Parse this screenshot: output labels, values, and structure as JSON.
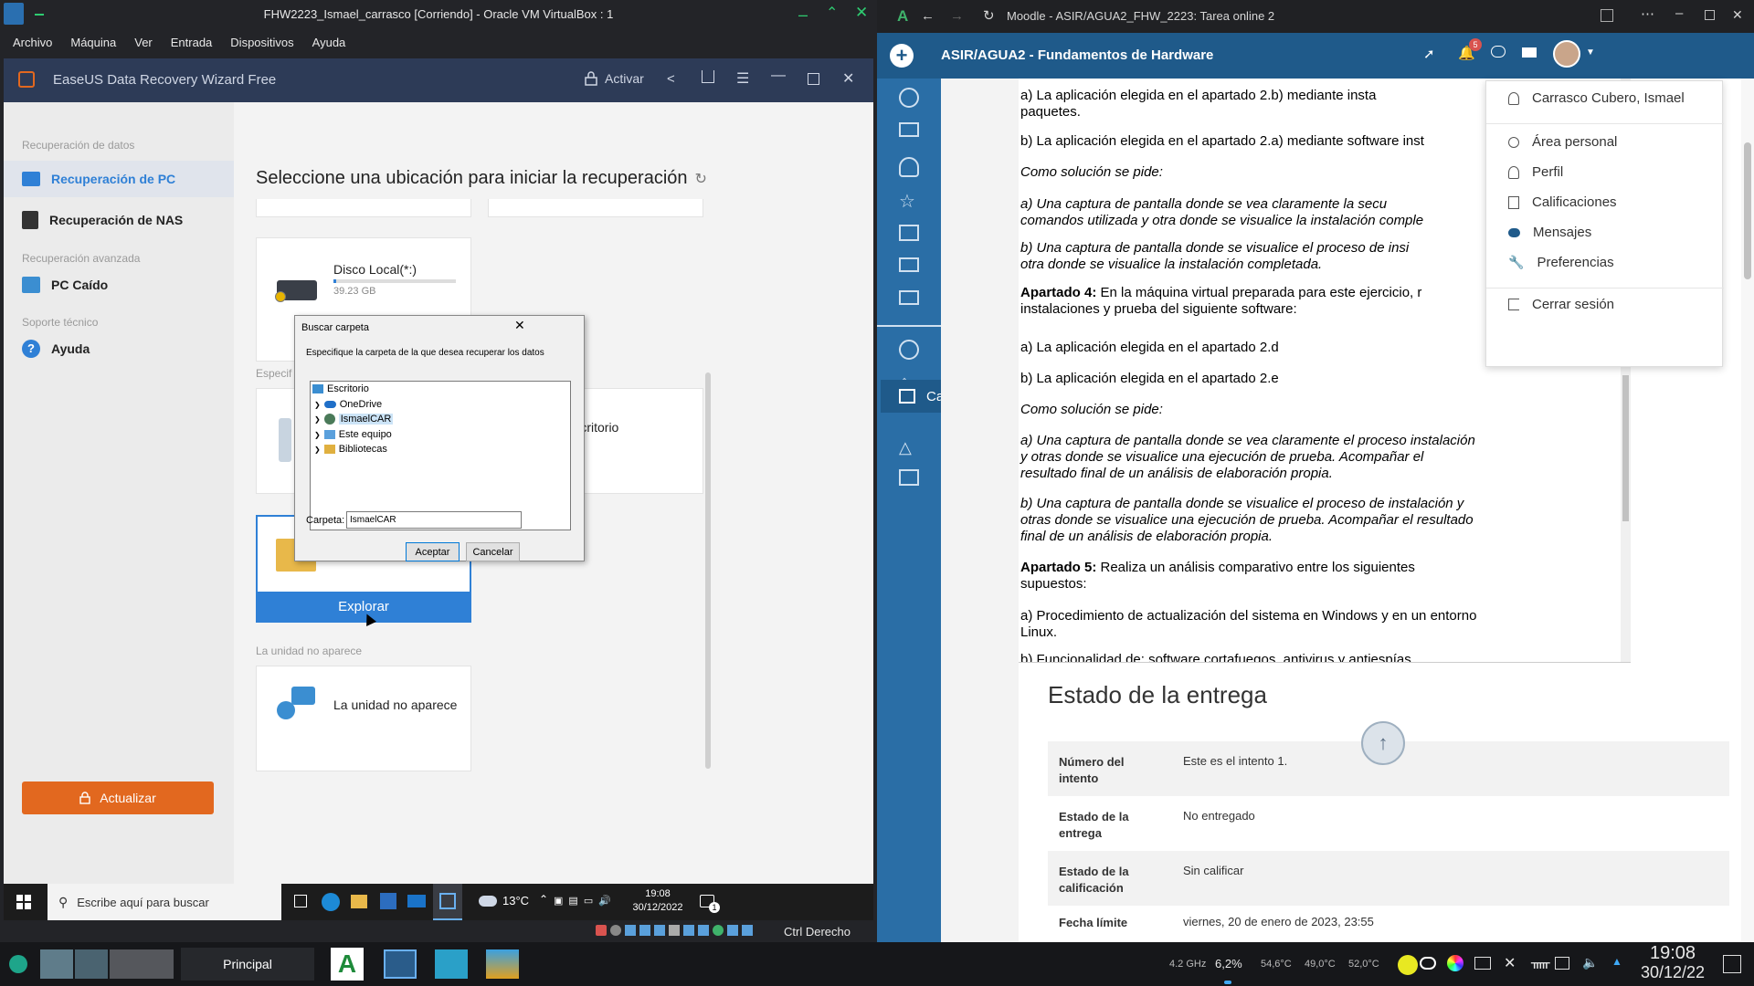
{
  "vbox": {
    "title": "FHW2223_Ismael_carrasco [Corriendo] - Oracle VM VirtualBox : 1",
    "menu": [
      "Archivo",
      "Máquina",
      "Ver",
      "Entrada",
      "Dispositivos",
      "Ayuda"
    ],
    "host_key": "Ctrl Derecho"
  },
  "easeus": {
    "app_title": "EaseUS Data Recovery Wizard Free",
    "activate_label": "Activar",
    "sidebar": {
      "section1": "Recuperación de datos",
      "item_pc": "Recuperación de PC",
      "item_nas": "Recuperación de NAS",
      "section2": "Recuperación avanzada",
      "item_crash": "PC Caído",
      "section3": "Soporte técnico",
      "item_help": "Ayuda",
      "update_label": "Actualizar"
    },
    "main_title": "Seleccione una ubicación para iniciar la recuperación",
    "disk_name": "Disco Local(*:)",
    "disk_size": "39.23 GB",
    "specify_section": "Especif",
    "desktop_label": "Escritorio",
    "explore_label": "Explorar",
    "missing_section": "La unidad no aparece",
    "missing_card": "La unidad no aparece",
    "disk_usage": 0.02
  },
  "dialog": {
    "title": "Buscar carpeta",
    "instruction": "Especifique la carpeta de la que desea recuperar los datos",
    "tree": [
      "Escritorio",
      "OneDrive",
      "IsmaelCAR",
      "Este equipo",
      "Bibliotecas"
    ],
    "folder_label": "Carpeta:",
    "folder_value": "IsmaelCAR",
    "ok_label": "Aceptar",
    "cancel_label": "Cancelar"
  },
  "guest_taskbar": {
    "search_placeholder": "Escribe aquí para buscar",
    "weather": "13°C",
    "time": "19:08",
    "date": "30/12/2022",
    "notif_count": "1"
  },
  "browser": {
    "tab_title": "Moodle - ASIR/AGUA2_FHW_2223: Tarea online 2",
    "course_title": "ASIR/AGUA2 - Fundamentos de Hardware",
    "notif_count": "5",
    "calendar_label": "Calendario",
    "doc": {
      "p1a": "a) La aplicación elegida en el apartado 2.b) mediante insta",
      "p1b": "paquetes.",
      "p2": "b) La aplicación elegida en el apartado 2.a) mediante software inst",
      "p3": "Como solución se pide:",
      "p4a": "a) Una captura de pantalla donde se vea claramente la secu",
      "p4b": "comandos utilizada y otra donde se visualice la instalación comple",
      "p5a": "b) Una captura de pantalla donde se visualice el proceso de insi",
      "p5b": "otra donde se visualice la instalación completada.",
      "p6_bold": "Apartado 4:",
      "p6a": " En la máquina virtual preparada para este ejercicio, r",
      "p6b": "instalaciones y prueba del siguiente software:",
      "p7": "a) La aplicación elegida en el apartado 2.d",
      "p8": "b) La aplicación elegida en el apartado 2.e",
      "p9": "Como solución se pide:",
      "p10a": "a) Una captura de pantalla donde se vea claramente el proceso instalación",
      "p10b": "y otras donde se visualice una ejecución de prueba. Acompañar el",
      "p10c": "resultado final de un análisis de elaboración propia.",
      "p11a": "b) Una captura de pantalla donde se visualice el proceso de instalación y",
      "p11b": "otras donde se visualice una ejecución de prueba. Acompañar el resultado",
      "p11c": "final de un análisis de elaboración propia.",
      "p12_bold": "Apartado 5:",
      "p12a": " Realiza un análisis comparativo entre los siguientes",
      "p12b": "supuestos:",
      "p13a": "a) Procedimiento de actualización del sistema en Windows y en un entorno",
      "p13b": "Linux.",
      "p14": "b) Funcionalidad de: software cortafuegos, antivirus y antiespías"
    },
    "estado_title": "Estado de la entrega",
    "estado_rows": [
      {
        "k": "Número del intento",
        "v": "Este es el intento 1."
      },
      {
        "k": "Estado de la entrega",
        "v": "No entregado"
      },
      {
        "k": "Estado de la calificación",
        "v": "Sin calificar"
      },
      {
        "k": "Fecha límite",
        "v": "viernes, 20 de enero de 2023, 23:55"
      }
    ],
    "user_menu": {
      "name": "Carrasco Cubero, Ismael",
      "area": "Área personal",
      "perfil": "Perfil",
      "calif": "Calificaciones",
      "mensajes": "Mensajes",
      "prefs": "Preferencias",
      "logout": "Cerrar sesión"
    }
  },
  "host_taskbar": {
    "principal": "Principal",
    "cpu_freq": "4.2 GHz",
    "cpu_load": "6,2%",
    "temp1": "54,6°C",
    "temp2": "49,0°C",
    "temp3": "52,0°C",
    "time": "19:08",
    "date": "30/12/22"
  },
  "colors": {
    "moodle_nav": "#1f5a8a",
    "moodle_side": "#2a6ea6",
    "easeus_header": "#2d3b57",
    "easeus_accent": "#2f80d6",
    "update_orange": "#e2681f"
  }
}
